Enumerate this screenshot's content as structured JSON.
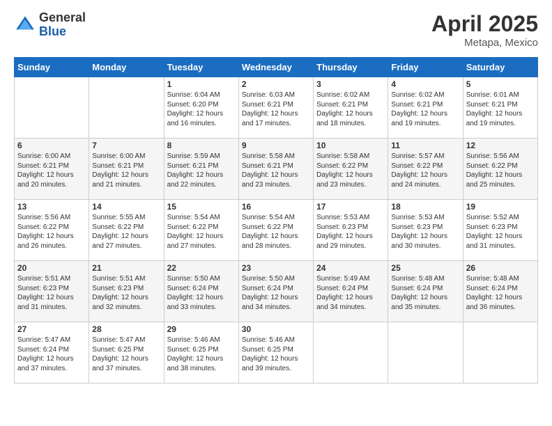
{
  "header": {
    "logo_general": "General",
    "logo_blue": "Blue",
    "title": "April 2025",
    "location": "Metapa, Mexico"
  },
  "days_of_week": [
    "Sunday",
    "Monday",
    "Tuesday",
    "Wednesday",
    "Thursday",
    "Friday",
    "Saturday"
  ],
  "weeks": [
    [
      {
        "day": "",
        "info": ""
      },
      {
        "day": "",
        "info": ""
      },
      {
        "day": "1",
        "info": "Sunrise: 6:04 AM\nSunset: 6:20 PM\nDaylight: 12 hours and 16 minutes."
      },
      {
        "day": "2",
        "info": "Sunrise: 6:03 AM\nSunset: 6:21 PM\nDaylight: 12 hours and 17 minutes."
      },
      {
        "day": "3",
        "info": "Sunrise: 6:02 AM\nSunset: 6:21 PM\nDaylight: 12 hours and 18 minutes."
      },
      {
        "day": "4",
        "info": "Sunrise: 6:02 AM\nSunset: 6:21 PM\nDaylight: 12 hours and 19 minutes."
      },
      {
        "day": "5",
        "info": "Sunrise: 6:01 AM\nSunset: 6:21 PM\nDaylight: 12 hours and 19 minutes."
      }
    ],
    [
      {
        "day": "6",
        "info": "Sunrise: 6:00 AM\nSunset: 6:21 PM\nDaylight: 12 hours and 20 minutes."
      },
      {
        "day": "7",
        "info": "Sunrise: 6:00 AM\nSunset: 6:21 PM\nDaylight: 12 hours and 21 minutes."
      },
      {
        "day": "8",
        "info": "Sunrise: 5:59 AM\nSunset: 6:21 PM\nDaylight: 12 hours and 22 minutes."
      },
      {
        "day": "9",
        "info": "Sunrise: 5:58 AM\nSunset: 6:21 PM\nDaylight: 12 hours and 23 minutes."
      },
      {
        "day": "10",
        "info": "Sunrise: 5:58 AM\nSunset: 6:22 PM\nDaylight: 12 hours and 23 minutes."
      },
      {
        "day": "11",
        "info": "Sunrise: 5:57 AM\nSunset: 6:22 PM\nDaylight: 12 hours and 24 minutes."
      },
      {
        "day": "12",
        "info": "Sunrise: 5:56 AM\nSunset: 6:22 PM\nDaylight: 12 hours and 25 minutes."
      }
    ],
    [
      {
        "day": "13",
        "info": "Sunrise: 5:56 AM\nSunset: 6:22 PM\nDaylight: 12 hours and 26 minutes."
      },
      {
        "day": "14",
        "info": "Sunrise: 5:55 AM\nSunset: 6:22 PM\nDaylight: 12 hours and 27 minutes."
      },
      {
        "day": "15",
        "info": "Sunrise: 5:54 AM\nSunset: 6:22 PM\nDaylight: 12 hours and 27 minutes."
      },
      {
        "day": "16",
        "info": "Sunrise: 5:54 AM\nSunset: 6:22 PM\nDaylight: 12 hours and 28 minutes."
      },
      {
        "day": "17",
        "info": "Sunrise: 5:53 AM\nSunset: 6:23 PM\nDaylight: 12 hours and 29 minutes."
      },
      {
        "day": "18",
        "info": "Sunrise: 5:53 AM\nSunset: 6:23 PM\nDaylight: 12 hours and 30 minutes."
      },
      {
        "day": "19",
        "info": "Sunrise: 5:52 AM\nSunset: 6:23 PM\nDaylight: 12 hours and 31 minutes."
      }
    ],
    [
      {
        "day": "20",
        "info": "Sunrise: 5:51 AM\nSunset: 6:23 PM\nDaylight: 12 hours and 31 minutes."
      },
      {
        "day": "21",
        "info": "Sunrise: 5:51 AM\nSunset: 6:23 PM\nDaylight: 12 hours and 32 minutes."
      },
      {
        "day": "22",
        "info": "Sunrise: 5:50 AM\nSunset: 6:24 PM\nDaylight: 12 hours and 33 minutes."
      },
      {
        "day": "23",
        "info": "Sunrise: 5:50 AM\nSunset: 6:24 PM\nDaylight: 12 hours and 34 minutes."
      },
      {
        "day": "24",
        "info": "Sunrise: 5:49 AM\nSunset: 6:24 PM\nDaylight: 12 hours and 34 minutes."
      },
      {
        "day": "25",
        "info": "Sunrise: 5:48 AM\nSunset: 6:24 PM\nDaylight: 12 hours and 35 minutes."
      },
      {
        "day": "26",
        "info": "Sunrise: 5:48 AM\nSunset: 6:24 PM\nDaylight: 12 hours and 36 minutes."
      }
    ],
    [
      {
        "day": "27",
        "info": "Sunrise: 5:47 AM\nSunset: 6:24 PM\nDaylight: 12 hours and 37 minutes."
      },
      {
        "day": "28",
        "info": "Sunrise: 5:47 AM\nSunset: 6:25 PM\nDaylight: 12 hours and 37 minutes."
      },
      {
        "day": "29",
        "info": "Sunrise: 5:46 AM\nSunset: 6:25 PM\nDaylight: 12 hours and 38 minutes."
      },
      {
        "day": "30",
        "info": "Sunrise: 5:46 AM\nSunset: 6:25 PM\nDaylight: 12 hours and 39 minutes."
      },
      {
        "day": "",
        "info": ""
      },
      {
        "day": "",
        "info": ""
      },
      {
        "day": "",
        "info": ""
      }
    ]
  ]
}
